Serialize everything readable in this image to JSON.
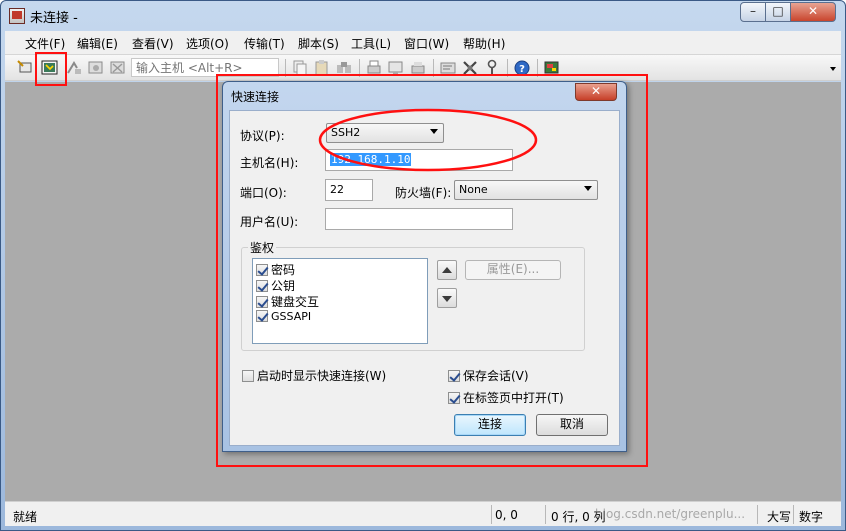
{
  "window": {
    "title": "未连接 -",
    "controls": {
      "minimize": "–",
      "maximize": "□",
      "close": "✕"
    }
  },
  "menu": [
    "文件(F)",
    "编辑(E)",
    "查看(V)",
    "选项(O)",
    "传输(T)",
    "脚本(S)",
    "工具(L)",
    "窗口(W)",
    "帮助(H)"
  ],
  "toolbar": {
    "host_placeholder": "输入主机 <Alt+R>",
    "icons": [
      "connect-icon",
      "quick-connect-icon",
      "connect-in-tab-icon",
      "reconnect-icon",
      "disconnect-icon",
      "copy-icon",
      "paste-icon",
      "find-icon",
      "print-icon",
      "print-screen-icon",
      "session-options-icon",
      "global-options-icon",
      "sftp-icon",
      "keymap-icon",
      "help-icon",
      "script-icon"
    ]
  },
  "dialog": {
    "title": "快速连接",
    "close": "✕",
    "protocol_label": "协议(P):",
    "protocol_value": "SSH2",
    "hostname_label": "主机名(H):",
    "hostname_value": "192.168.1.10",
    "port_label": "端口(O):",
    "port_value": "22",
    "firewall_label": "防火墙(F):",
    "firewall_value": "None",
    "username_label": "用户名(U):",
    "username_value": "",
    "auth_group_label": "鉴权",
    "auth_methods": [
      {
        "label": "密码",
        "checked": true
      },
      {
        "label": "公钥",
        "checked": true
      },
      {
        "label": "键盘交互",
        "checked": true
      },
      {
        "label": "GSSAPI",
        "checked": true
      }
    ],
    "properties_button": "属性(E)...",
    "show_on_startup": {
      "label": "启动时显示快速连接(W)",
      "checked": false
    },
    "save_session": {
      "label": "保存会话(V)",
      "checked": true
    },
    "open_in_tab": {
      "label": "在标签页中打开(T)",
      "checked": true
    },
    "connect_button": "连接",
    "cancel_button": "取消"
  },
  "statusbar": {
    "status": "就绪",
    "position": "0, 0",
    "rows_cols": "0 行, 0 列",
    "watermark": "blog.csdn.net/greenplu...",
    "caps": "大写",
    "num": "数字"
  },
  "annotation_color": "#ff1010"
}
